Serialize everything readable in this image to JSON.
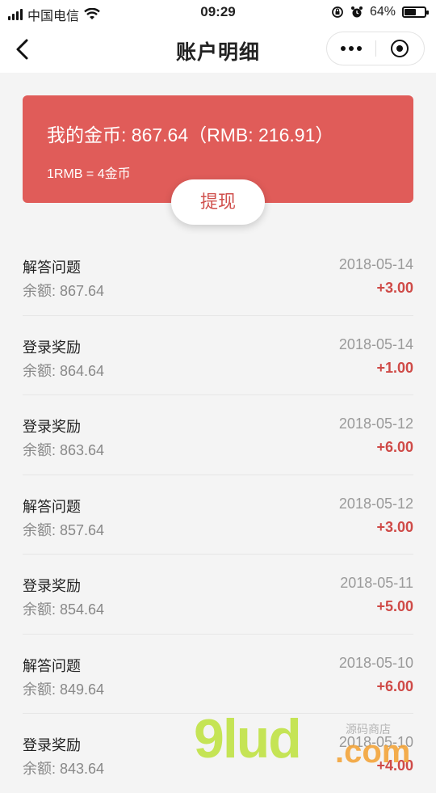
{
  "status_bar": {
    "carrier": "中国电信",
    "time": "09:29",
    "battery": "64%",
    "battery_level": 0.64
  },
  "nav": {
    "title": "账户明细"
  },
  "account": {
    "coins_text": "我的金币: 867.64（RMB: 216.91）",
    "rate_text": "1RMB = 4金币",
    "withdraw_label": "提现"
  },
  "transactions": [
    {
      "name": "解答问题",
      "balance": "余额: 867.64",
      "date": "2018-05-14",
      "amount": "+3.00"
    },
    {
      "name": "登录奖励",
      "balance": "余额: 864.64",
      "date": "2018-05-14",
      "amount": "+1.00"
    },
    {
      "name": "登录奖励",
      "balance": "余额: 863.64",
      "date": "2018-05-12",
      "amount": "+6.00"
    },
    {
      "name": "解答问题",
      "balance": "余额: 857.64",
      "date": "2018-05-12",
      "amount": "+3.00"
    },
    {
      "name": "登录奖励",
      "balance": "余额: 854.64",
      "date": "2018-05-11",
      "amount": "+5.00"
    },
    {
      "name": "解答问题",
      "balance": "余额: 849.64",
      "date": "2018-05-10",
      "amount": "+6.00"
    },
    {
      "name": "登录奖励",
      "balance": "余额: 843.64",
      "date": "2018-05-10",
      "amount": "+4.00"
    }
  ],
  "watermark": {
    "main": "9lud",
    "suffix": ".com",
    "small": "源码商店"
  },
  "colors": {
    "accent": "#e05c59",
    "amount": "#cf4a47"
  }
}
